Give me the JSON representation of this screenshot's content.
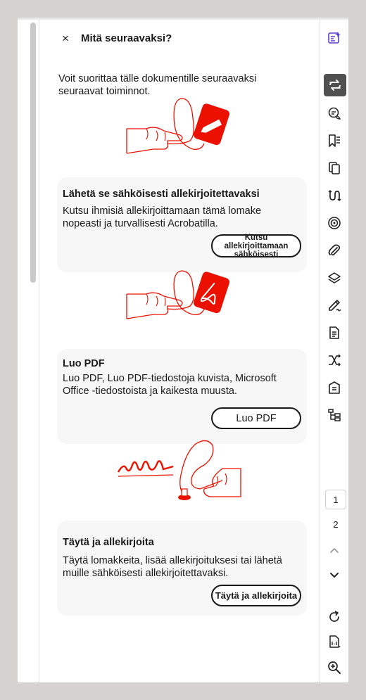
{
  "panel": {
    "close_symbol": "×",
    "title": "Mitä seuraavaksi?",
    "intro": "Voit suorittaa tälle dokumentille seuraavaksi seuraavat toiminnot."
  },
  "cards": [
    {
      "title": "Lähetä se sähköisesti allekirjoitettavaksi",
      "description": "Kutsu ihmisiä allekirjoittamaan tämä lomake nopeasti ja turvallisesti Acrobatilla.",
      "button_line1": "Kutsu allekirjoittamaan",
      "button_line2": "sähköisesti"
    },
    {
      "title": "Luo PDF",
      "description": "Luo PDF, Luo PDF-tiedostoja kuvista, Microsoft Office -tiedostoista ja kaikesta muusta.",
      "button": "Luo PDF"
    },
    {
      "title": "Täytä ja allekirjoita",
      "description": "Täytä lomakkeita, lisää allekirjoituksesi tai lähetä muille sähköisesti allekirjoitettavaksi.",
      "button": "Täytä ja allekirjoita"
    }
  ],
  "page_nav": {
    "current": "1",
    "next": "2"
  },
  "icons": {
    "right_toolbar": [
      "ai-assistant-icon",
      "convert-icon",
      "comment-icon",
      "bookmark-icon",
      "pages-icon",
      "compare-icon",
      "redact-icon",
      "attachment-icon",
      "layers-icon",
      "sign-icon",
      "document-icon",
      "organize-icon",
      "protect-icon",
      "structure-icon",
      "page-up-icon",
      "page-down-icon",
      "rotate-icon",
      "actual-size-icon",
      "zoom-in-icon",
      "zoom-out-icon"
    ]
  },
  "colors": {
    "accent_red": "#eb1000",
    "active_tool": "#505050",
    "card_bg": "#f7f7f7",
    "ai_purple": "#5a3fd1"
  }
}
